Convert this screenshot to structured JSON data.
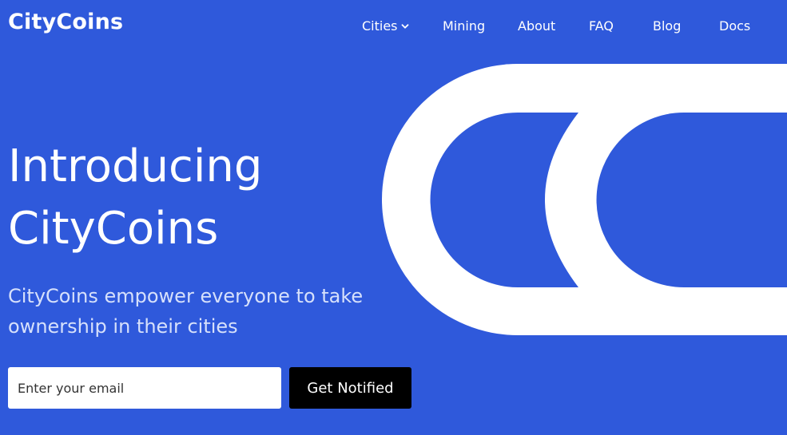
{
  "brand": {
    "logo_text": "CityCoins"
  },
  "nav": {
    "items": [
      {
        "label": "Cities",
        "has_dropdown": true
      },
      {
        "label": "Mining"
      },
      {
        "label": "About"
      },
      {
        "label": "FAQ"
      },
      {
        "label": "Blog"
      },
      {
        "label": "Docs"
      }
    ],
    "dropdown_icon": "chevron-down-icon"
  },
  "hero": {
    "title_line1": "Introducing",
    "title_line2": "CityCoins",
    "subtitle": "CityCoins empower everyone to take ownership in their cities",
    "graphic": "citycoins-cc-mark"
  },
  "signup": {
    "email_placeholder": "Enter your email",
    "email_value": "",
    "button_label": "Get Notified"
  },
  "colors": {
    "background": "#2f59db",
    "text": "#ffffff",
    "subtitle": "#d6e0fb",
    "button": "#000000"
  }
}
